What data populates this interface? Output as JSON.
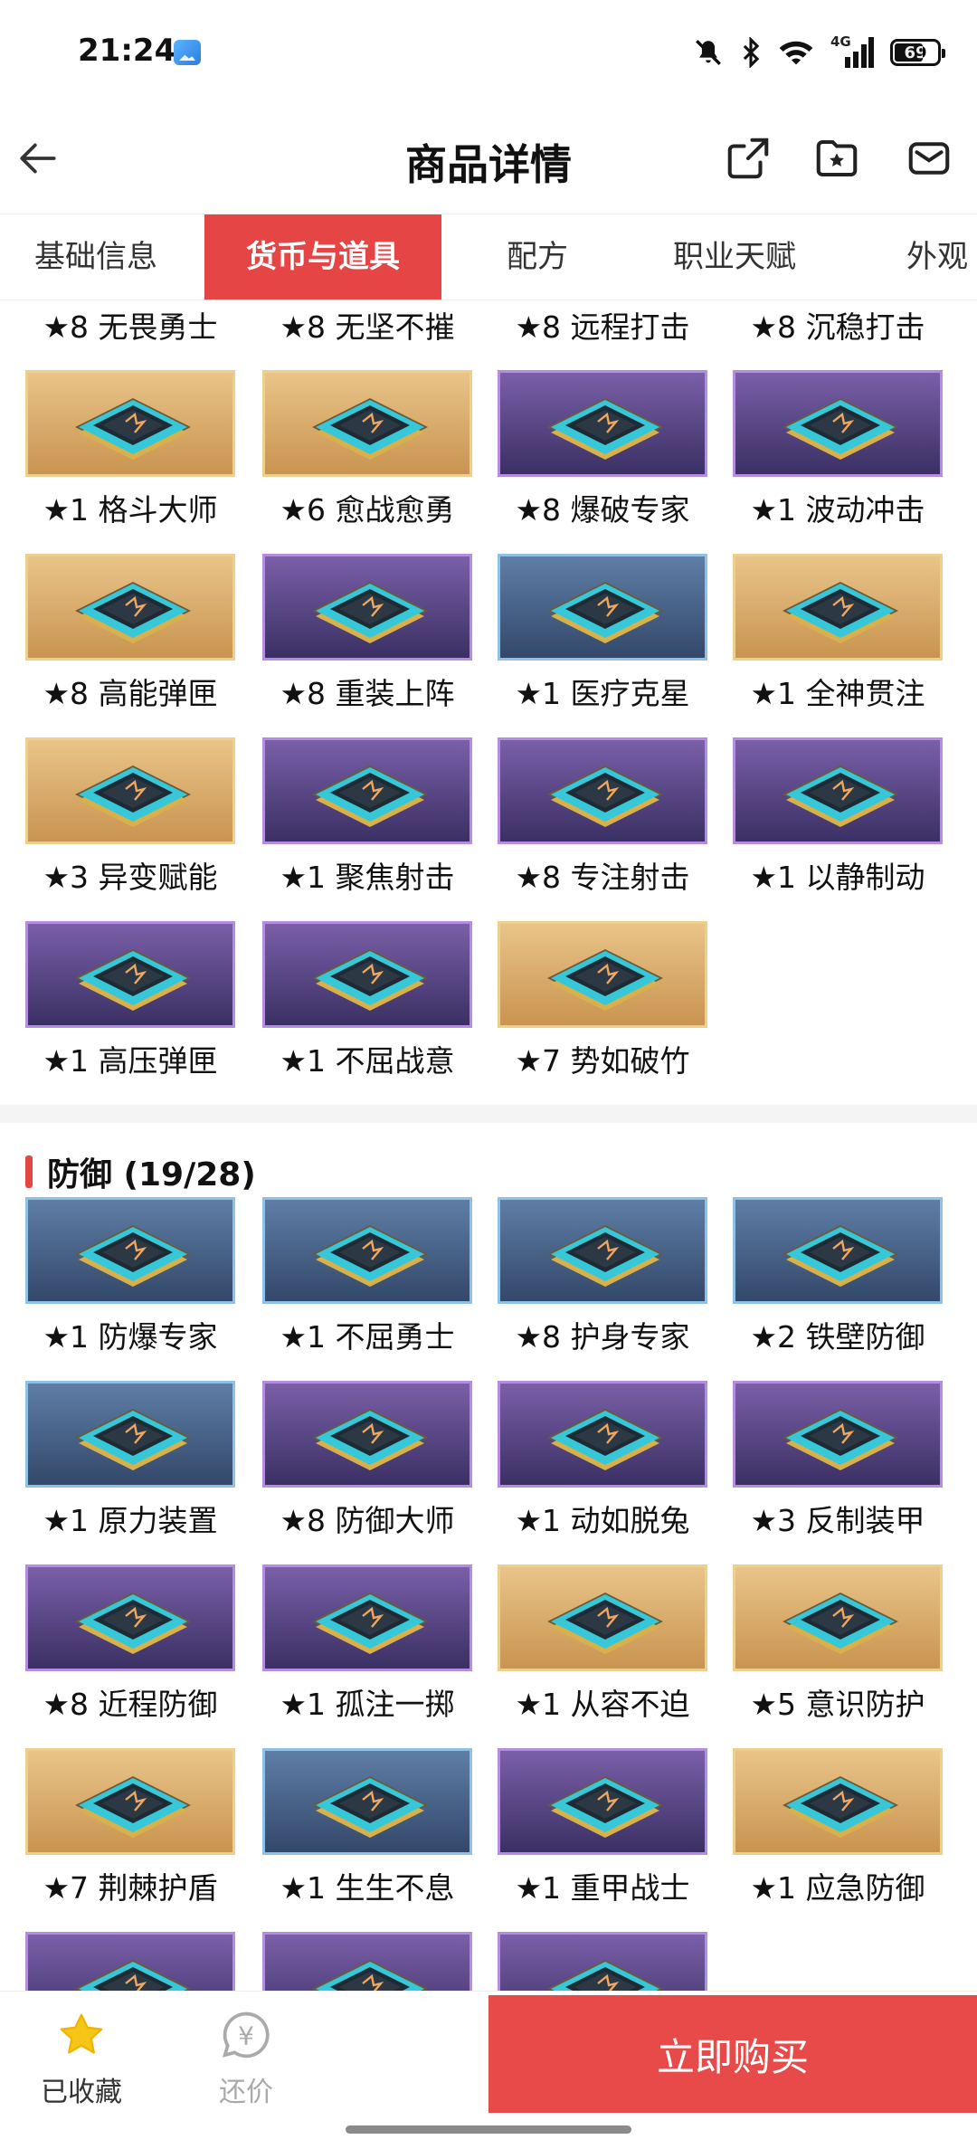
{
  "status_bar": {
    "time": "21:24",
    "network": "4G",
    "battery": "69"
  },
  "header": {
    "title": "商品详情"
  },
  "tabs": [
    {
      "label": "基础信息",
      "active": false
    },
    {
      "label": "货币与道具",
      "active": true
    },
    {
      "label": "配方",
      "active": false
    },
    {
      "label": "职业天赋",
      "active": false
    },
    {
      "label": "外观",
      "active": false
    }
  ],
  "top_partial_labels": [
    "★8 无畏勇士",
    "★8 无坚不摧",
    "★8 远程打击",
    "★8 沉稳打击"
  ],
  "offense_items": [
    {
      "label": "★1 格斗大师",
      "rarity": "gold"
    },
    {
      "label": "★6 愈战愈勇",
      "rarity": "gold"
    },
    {
      "label": "★8 爆破专家",
      "rarity": "purple"
    },
    {
      "label": "★1 波动冲击",
      "rarity": "purple"
    },
    {
      "label": "★8 高能弹匣",
      "rarity": "gold"
    },
    {
      "label": "★8 重装上阵",
      "rarity": "purple"
    },
    {
      "label": "★1 医疗克星",
      "rarity": "blue"
    },
    {
      "label": "★1 全神贯注",
      "rarity": "gold"
    },
    {
      "label": "★3 异变赋能",
      "rarity": "gold"
    },
    {
      "label": "★1 聚焦射击",
      "rarity": "purple"
    },
    {
      "label": "★8 专注射击",
      "rarity": "purple"
    },
    {
      "label": "★1 以静制动",
      "rarity": "purple"
    },
    {
      "label": "★1 高压弹匣",
      "rarity": "purple"
    },
    {
      "label": "★1 不屈战意",
      "rarity": "purple"
    },
    {
      "label": "★7 势如破竹",
      "rarity": "gold"
    }
  ],
  "defense_section": {
    "title": "防御 (19/28)",
    "items": [
      {
        "label": "★1 防爆专家",
        "rarity": "blue"
      },
      {
        "label": "★1 不屈勇士",
        "rarity": "blue"
      },
      {
        "label": "★8 护身专家",
        "rarity": "blue"
      },
      {
        "label": "★2 铁壁防御",
        "rarity": "blue"
      },
      {
        "label": "★1 原力装置",
        "rarity": "blue"
      },
      {
        "label": "★8 防御大师",
        "rarity": "purple"
      },
      {
        "label": "★1 动如脱兔",
        "rarity": "purple"
      },
      {
        "label": "★3 反制装甲",
        "rarity": "purple"
      },
      {
        "label": "★8 近程防御",
        "rarity": "purple"
      },
      {
        "label": "★1 孤注一掷",
        "rarity": "purple"
      },
      {
        "label": "★1 从容不迫",
        "rarity": "gold"
      },
      {
        "label": "★5 意识防护",
        "rarity": "gold"
      },
      {
        "label": "★7 荆棘护盾",
        "rarity": "gold"
      },
      {
        "label": "★1 生生不息",
        "rarity": "blue"
      },
      {
        "label": "★1 重甲战士",
        "rarity": "purple"
      },
      {
        "label": "★1 应急防御",
        "rarity": "gold"
      },
      {
        "label": "",
        "rarity": "purple"
      },
      {
        "label": "",
        "rarity": "purple"
      },
      {
        "label": "",
        "rarity": "purple"
      }
    ]
  },
  "bottom_bar": {
    "favorite_label": "已收藏",
    "bargain_label": "还价",
    "bargain_symbol": "¥",
    "buy_label": "立即购买"
  },
  "colors": {
    "accent": "#e64545",
    "gold": "#d9a861",
    "purple": "#5a4585",
    "blue": "#476489"
  }
}
